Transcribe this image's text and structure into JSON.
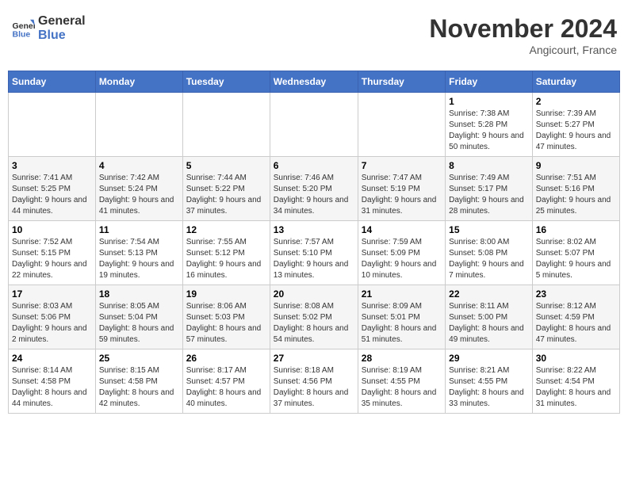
{
  "header": {
    "logo_general": "General",
    "logo_blue": "Blue",
    "month_title": "November 2024",
    "location": "Angicourt, France"
  },
  "days_of_week": [
    "Sunday",
    "Monday",
    "Tuesday",
    "Wednesday",
    "Thursday",
    "Friday",
    "Saturday"
  ],
  "weeks": [
    [
      {
        "day": "",
        "sunrise": "",
        "sunset": "",
        "daylight": ""
      },
      {
        "day": "",
        "sunrise": "",
        "sunset": "",
        "daylight": ""
      },
      {
        "day": "",
        "sunrise": "",
        "sunset": "",
        "daylight": ""
      },
      {
        "day": "",
        "sunrise": "",
        "sunset": "",
        "daylight": ""
      },
      {
        "day": "",
        "sunrise": "",
        "sunset": "",
        "daylight": ""
      },
      {
        "day": "1",
        "sunrise": "Sunrise: 7:38 AM",
        "sunset": "Sunset: 5:28 PM",
        "daylight": "Daylight: 9 hours and 50 minutes."
      },
      {
        "day": "2",
        "sunrise": "Sunrise: 7:39 AM",
        "sunset": "Sunset: 5:27 PM",
        "daylight": "Daylight: 9 hours and 47 minutes."
      }
    ],
    [
      {
        "day": "3",
        "sunrise": "Sunrise: 7:41 AM",
        "sunset": "Sunset: 5:25 PM",
        "daylight": "Daylight: 9 hours and 44 minutes."
      },
      {
        "day": "4",
        "sunrise": "Sunrise: 7:42 AM",
        "sunset": "Sunset: 5:24 PM",
        "daylight": "Daylight: 9 hours and 41 minutes."
      },
      {
        "day": "5",
        "sunrise": "Sunrise: 7:44 AM",
        "sunset": "Sunset: 5:22 PM",
        "daylight": "Daylight: 9 hours and 37 minutes."
      },
      {
        "day": "6",
        "sunrise": "Sunrise: 7:46 AM",
        "sunset": "Sunset: 5:20 PM",
        "daylight": "Daylight: 9 hours and 34 minutes."
      },
      {
        "day": "7",
        "sunrise": "Sunrise: 7:47 AM",
        "sunset": "Sunset: 5:19 PM",
        "daylight": "Daylight: 9 hours and 31 minutes."
      },
      {
        "day": "8",
        "sunrise": "Sunrise: 7:49 AM",
        "sunset": "Sunset: 5:17 PM",
        "daylight": "Daylight: 9 hours and 28 minutes."
      },
      {
        "day": "9",
        "sunrise": "Sunrise: 7:51 AM",
        "sunset": "Sunset: 5:16 PM",
        "daylight": "Daylight: 9 hours and 25 minutes."
      }
    ],
    [
      {
        "day": "10",
        "sunrise": "Sunrise: 7:52 AM",
        "sunset": "Sunset: 5:15 PM",
        "daylight": "Daylight: 9 hours and 22 minutes."
      },
      {
        "day": "11",
        "sunrise": "Sunrise: 7:54 AM",
        "sunset": "Sunset: 5:13 PM",
        "daylight": "Daylight: 9 hours and 19 minutes."
      },
      {
        "day": "12",
        "sunrise": "Sunrise: 7:55 AM",
        "sunset": "Sunset: 5:12 PM",
        "daylight": "Daylight: 9 hours and 16 minutes."
      },
      {
        "day": "13",
        "sunrise": "Sunrise: 7:57 AM",
        "sunset": "Sunset: 5:10 PM",
        "daylight": "Daylight: 9 hours and 13 minutes."
      },
      {
        "day": "14",
        "sunrise": "Sunrise: 7:59 AM",
        "sunset": "Sunset: 5:09 PM",
        "daylight": "Daylight: 9 hours and 10 minutes."
      },
      {
        "day": "15",
        "sunrise": "Sunrise: 8:00 AM",
        "sunset": "Sunset: 5:08 PM",
        "daylight": "Daylight: 9 hours and 7 minutes."
      },
      {
        "day": "16",
        "sunrise": "Sunrise: 8:02 AM",
        "sunset": "Sunset: 5:07 PM",
        "daylight": "Daylight: 9 hours and 5 minutes."
      }
    ],
    [
      {
        "day": "17",
        "sunrise": "Sunrise: 8:03 AM",
        "sunset": "Sunset: 5:06 PM",
        "daylight": "Daylight: 9 hours and 2 minutes."
      },
      {
        "day": "18",
        "sunrise": "Sunrise: 8:05 AM",
        "sunset": "Sunset: 5:04 PM",
        "daylight": "Daylight: 8 hours and 59 minutes."
      },
      {
        "day": "19",
        "sunrise": "Sunrise: 8:06 AM",
        "sunset": "Sunset: 5:03 PM",
        "daylight": "Daylight: 8 hours and 57 minutes."
      },
      {
        "day": "20",
        "sunrise": "Sunrise: 8:08 AM",
        "sunset": "Sunset: 5:02 PM",
        "daylight": "Daylight: 8 hours and 54 minutes."
      },
      {
        "day": "21",
        "sunrise": "Sunrise: 8:09 AM",
        "sunset": "Sunset: 5:01 PM",
        "daylight": "Daylight: 8 hours and 51 minutes."
      },
      {
        "day": "22",
        "sunrise": "Sunrise: 8:11 AM",
        "sunset": "Sunset: 5:00 PM",
        "daylight": "Daylight: 8 hours and 49 minutes."
      },
      {
        "day": "23",
        "sunrise": "Sunrise: 8:12 AM",
        "sunset": "Sunset: 4:59 PM",
        "daylight": "Daylight: 8 hours and 47 minutes."
      }
    ],
    [
      {
        "day": "24",
        "sunrise": "Sunrise: 8:14 AM",
        "sunset": "Sunset: 4:58 PM",
        "daylight": "Daylight: 8 hours and 44 minutes."
      },
      {
        "day": "25",
        "sunrise": "Sunrise: 8:15 AM",
        "sunset": "Sunset: 4:58 PM",
        "daylight": "Daylight: 8 hours and 42 minutes."
      },
      {
        "day": "26",
        "sunrise": "Sunrise: 8:17 AM",
        "sunset": "Sunset: 4:57 PM",
        "daylight": "Daylight: 8 hours and 40 minutes."
      },
      {
        "day": "27",
        "sunrise": "Sunrise: 8:18 AM",
        "sunset": "Sunset: 4:56 PM",
        "daylight": "Daylight: 8 hours and 37 minutes."
      },
      {
        "day": "28",
        "sunrise": "Sunrise: 8:19 AM",
        "sunset": "Sunset: 4:55 PM",
        "daylight": "Daylight: 8 hours and 35 minutes."
      },
      {
        "day": "29",
        "sunrise": "Sunrise: 8:21 AM",
        "sunset": "Sunset: 4:55 PM",
        "daylight": "Daylight: 8 hours and 33 minutes."
      },
      {
        "day": "30",
        "sunrise": "Sunrise: 8:22 AM",
        "sunset": "Sunset: 4:54 PM",
        "daylight": "Daylight: 8 hours and 31 minutes."
      }
    ]
  ]
}
